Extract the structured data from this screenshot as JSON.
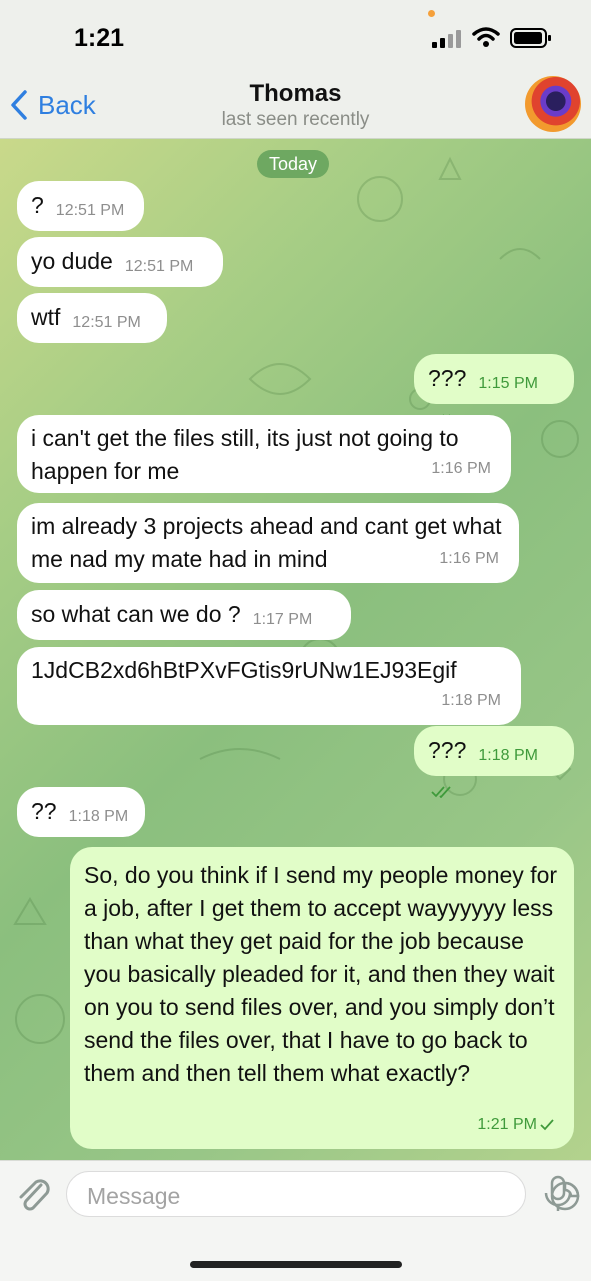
{
  "status_bar": {
    "time": "1:21"
  },
  "header": {
    "back_label": "Back",
    "title": "Thomas",
    "subtitle": "last seen recently"
  },
  "date_separator": "Today",
  "messages": [
    {
      "dir": "in",
      "text": "?",
      "time": "12:51 PM"
    },
    {
      "dir": "in",
      "text": "yo dude",
      "time": "12:51 PM"
    },
    {
      "dir": "in",
      "text": "wtf",
      "time": "12:51 PM"
    },
    {
      "dir": "out",
      "text": "???",
      "time": "1:15 PM",
      "read": true
    },
    {
      "dir": "in",
      "text": "i can't get the files still, its just not going to happen for me",
      "time": "1:16 PM"
    },
    {
      "dir": "in",
      "text": "im already 3 projects ahead and cant get what me nad my mate had in mind",
      "time": "1:16 PM"
    },
    {
      "dir": "in",
      "text": "so what can we do ?",
      "time": "1:17 PM"
    },
    {
      "dir": "in",
      "text": "1JdCB2xd6hBtPXvFGtis9rUNw1EJ93Egif",
      "time": "1:18 PM"
    },
    {
      "dir": "out",
      "text": "???",
      "time": "1:18 PM",
      "read": true
    },
    {
      "dir": "in",
      "text": "??",
      "time": "1:18 PM"
    },
    {
      "dir": "out",
      "text": "So, do you think if I send my people money for a job, after I get them to accept wayyyyyy less than what they get paid for the job because you basically pleaded for it, and then they wait on you to send files over, and you simply don’t send the files over, that I have to go back to them and then tell them what exactly?",
      "time": "1:21 PM",
      "read": false
    }
  ],
  "composer": {
    "placeholder": "Message"
  },
  "colors": {
    "accent": "#2f7fe0",
    "incoming": "#ffffff",
    "outgoing": "#e1fdc8",
    "time_outgoing": "#3f9a3b",
    "date_chip": "#6ea861"
  },
  "icons": {
    "back": "chevron-left-icon",
    "attach": "paperclip-icon",
    "sticker": "sticker-icon",
    "mic": "microphone-icon",
    "read": "double-check-icon",
    "sent": "single-check-icon"
  }
}
